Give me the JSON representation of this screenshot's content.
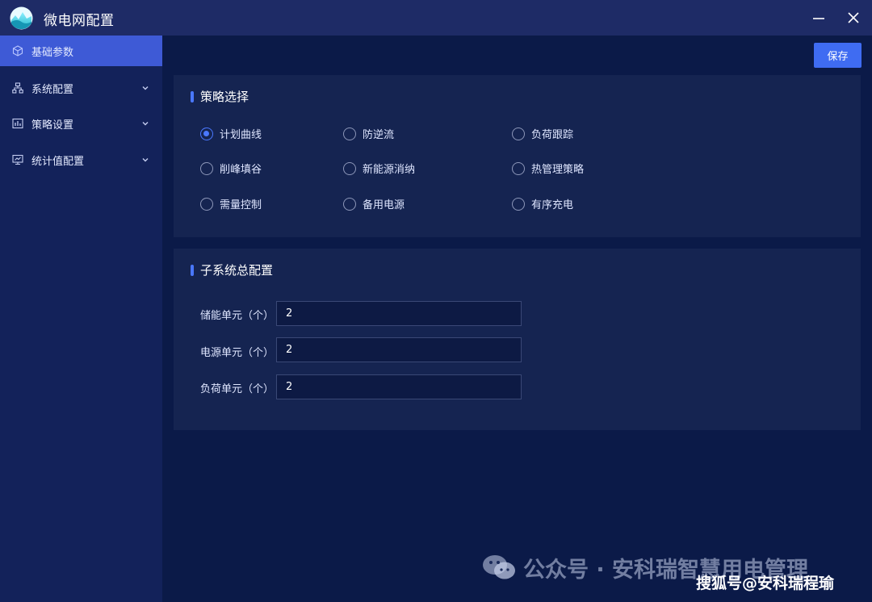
{
  "window": {
    "title": "微电网配置",
    "logo_icon": "app-logo-icon",
    "minimize_icon": "minimize-icon",
    "close_icon": "close-icon"
  },
  "sidebar": {
    "items": [
      {
        "label": "基础参数",
        "icon": "cube-icon",
        "active": true,
        "expandable": false
      },
      {
        "label": "系统配置",
        "icon": "org-chart-icon",
        "active": false,
        "expandable": true
      },
      {
        "label": "策略设置",
        "icon": "chart-icon",
        "active": false,
        "expandable": true
      },
      {
        "label": "统计值配置",
        "icon": "monitor-icon",
        "active": false,
        "expandable": true
      }
    ]
  },
  "toolbar": {
    "save_label": "保存"
  },
  "strategy": {
    "title": "策略选择",
    "selected": "计划曲线",
    "options": [
      "计划曲线",
      "防逆流",
      "负荷跟踪",
      "削峰填谷",
      "新能源消纳",
      "热管理策略",
      "需量控制",
      "备用电源",
      "有序充电"
    ]
  },
  "subsystem": {
    "title": "子系统总配置",
    "fields": [
      {
        "label": "储能单元（个）",
        "value": "2"
      },
      {
        "label": "电源单元（个）",
        "value": "2"
      },
      {
        "label": "负荷单元（个）",
        "value": "2"
      }
    ]
  },
  "watermark": {
    "text": "公众号 · 安科瑞智慧用电管理",
    "brand": "搜狐号@安科瑞程瑜",
    "icon": "wechat-icon"
  },
  "colors": {
    "accent": "#3f6cf2",
    "active_nav": "#3e5ad6",
    "radio_checked": "#4a78ff",
    "titlebar": "#1e2b66",
    "sidebar": "#13225a",
    "content_bg": "#0b1a48",
    "card_bg": "#152451"
  }
}
